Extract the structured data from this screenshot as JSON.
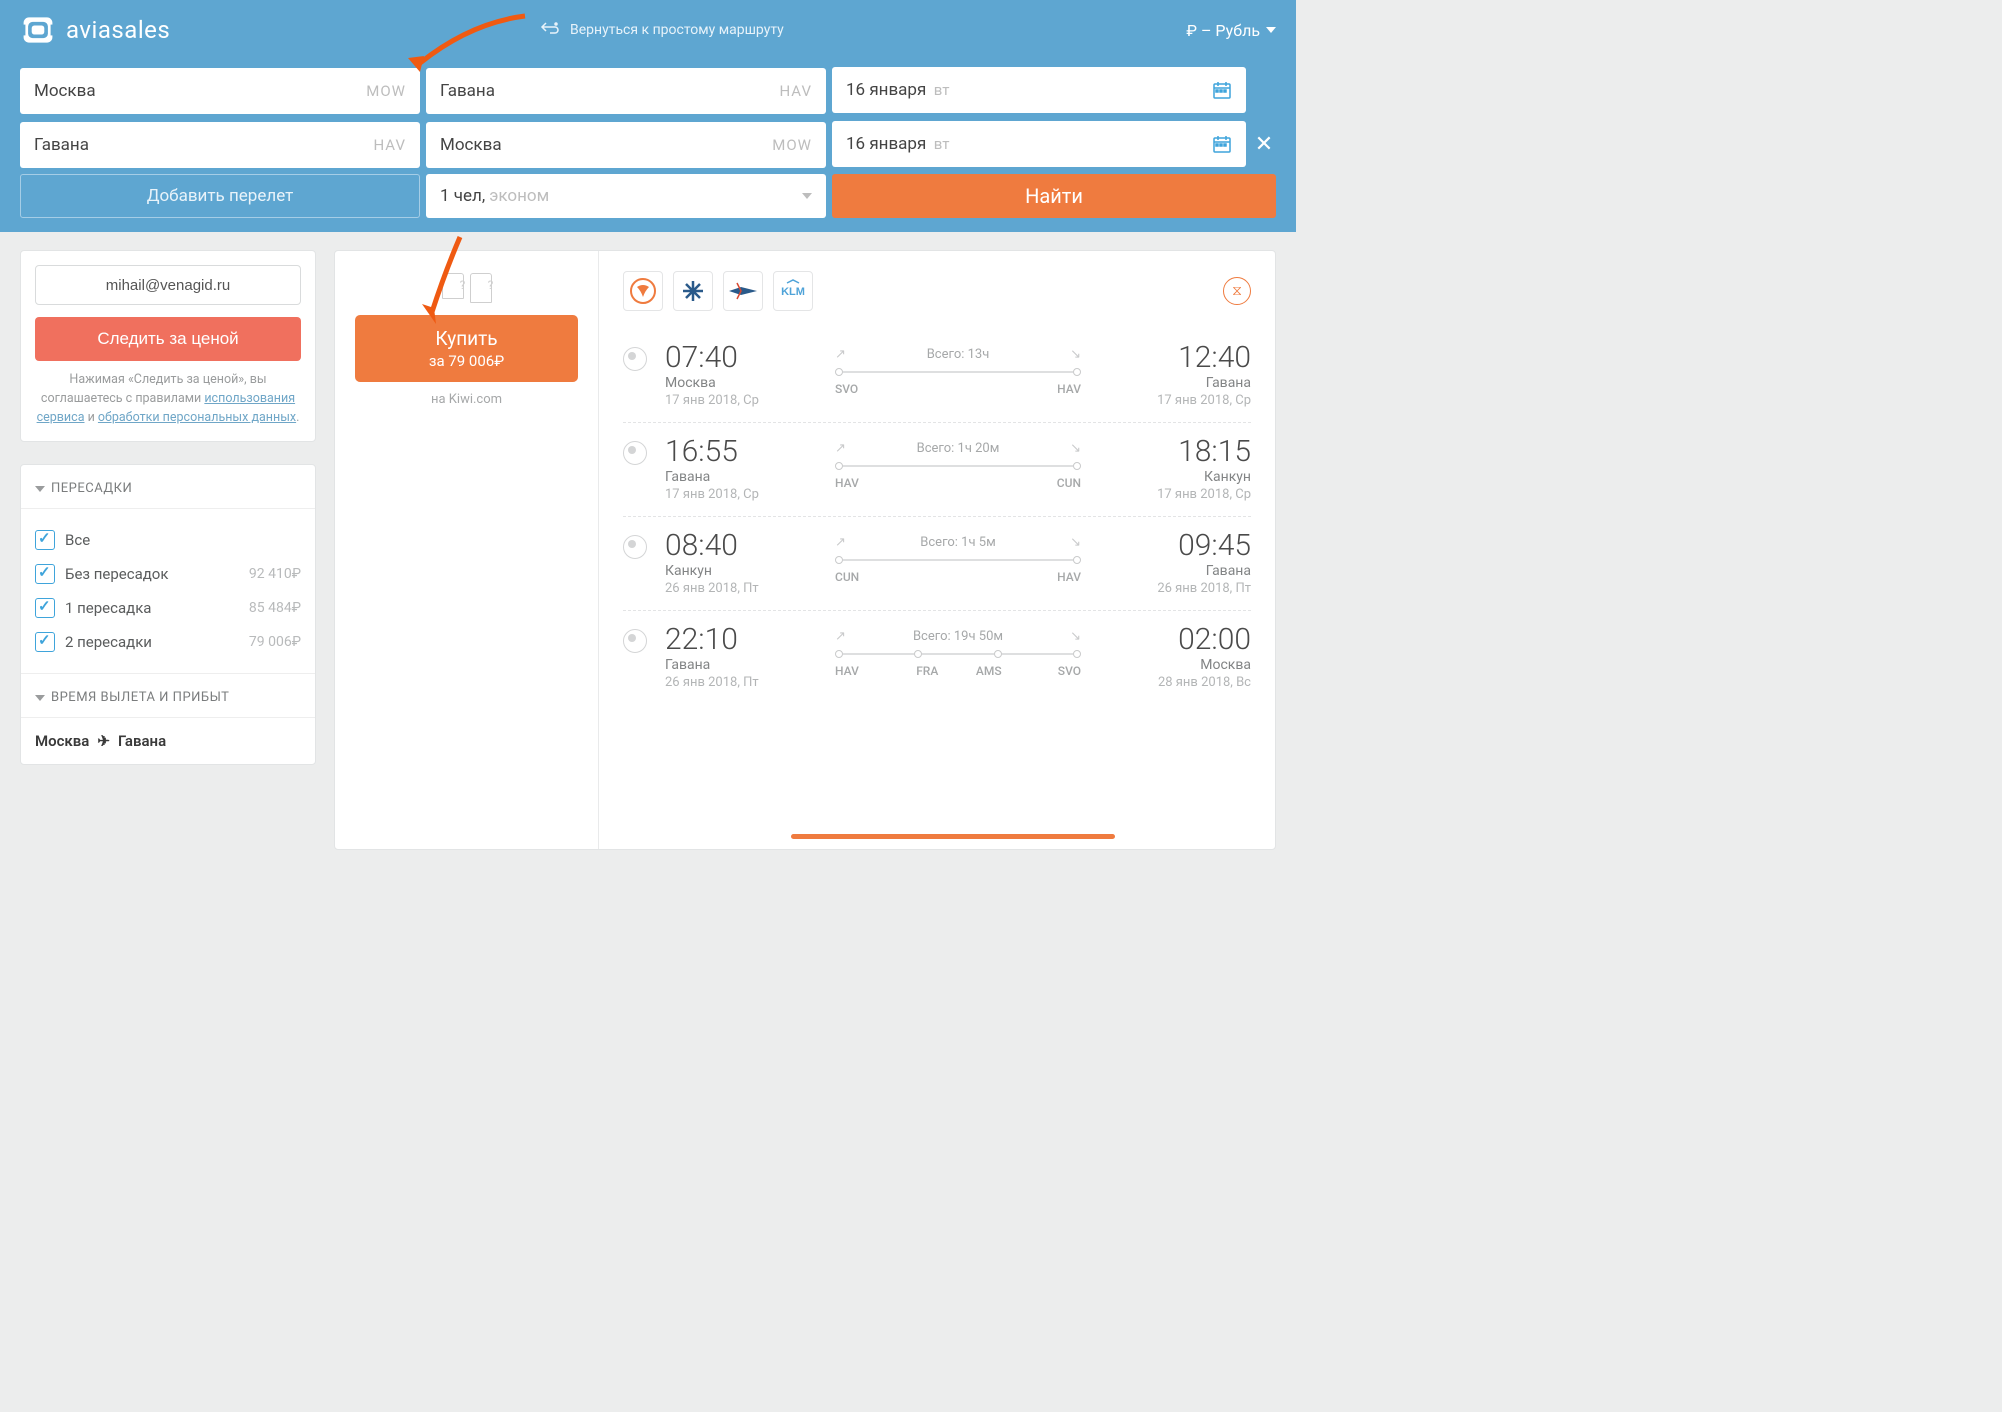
{
  "brand": "aviasales",
  "topbar": {
    "simple_route": "Вернуться к простому маршруту",
    "currency": "₽ – Рубль"
  },
  "search": {
    "rows": [
      {
        "from": "Москва",
        "from_code": "MOW",
        "to": "Гавана",
        "to_code": "HAV",
        "date": "16 января",
        "dow": "вт"
      },
      {
        "from": "Гавана",
        "from_code": "HAV",
        "to": "Москва",
        "to_code": "MOW",
        "date": "16 января",
        "dow": "вт"
      }
    ],
    "add_flight": "Добавить перелет",
    "pax_count": "1 чел,",
    "pax_class": "эконом",
    "submit": "Найти"
  },
  "sidebar": {
    "email": "mihail@venagid.ru",
    "watch": "Следить за ценой",
    "disclaimer_pre": "Нажимая «Следить за ценой», вы соглашаетесь с правилами ",
    "disclaimer_link1": "использования сервиса",
    "disclaimer_mid": " и ",
    "disclaimer_link2": "обработки персональных данных",
    "disclaimer_post": ".",
    "filters": {
      "transfers_title": "ПЕРЕСАДКИ",
      "items": [
        {
          "label": "Все",
          "price": ""
        },
        {
          "label": "Без пересадок",
          "price": "92 410₽"
        },
        {
          "label": "1 пересадка",
          "price": "85 484₽"
        },
        {
          "label": "2 пересадки",
          "price": "79 006₽"
        }
      ],
      "time_title": "ВРЕМЯ ВЫЛЕТА И ПРИБЫТ"
    },
    "route_from": "Москва",
    "route_to": "Гавана"
  },
  "ticket": {
    "buy_label": "Купить",
    "buy_price": "за 79 006₽",
    "via": "на Kiwi.com",
    "airlines": [
      "condor",
      "interjet",
      "aeroflot",
      "klm"
    ],
    "segments": [
      {
        "dep_time": "07:40",
        "dep_city": "Москва",
        "dep_date": "17 янв 2018, Ср",
        "arr_time": "12:40",
        "arr_city": "Гавана",
        "arr_date": "17 янв 2018, Ср",
        "duration": "Всего: 13ч",
        "stops": [
          "SVO",
          "HAV"
        ]
      },
      {
        "dep_time": "16:55",
        "dep_city": "Гавана",
        "dep_date": "17 янв 2018, Ср",
        "arr_time": "18:15",
        "arr_city": "Канкун",
        "arr_date": "17 янв 2018, Ср",
        "duration": "Всего: 1ч 20м",
        "stops": [
          "HAV",
          "CUN"
        ]
      },
      {
        "dep_time": "08:40",
        "dep_city": "Канкун",
        "dep_date": "26 янв 2018, Пт",
        "arr_time": "09:45",
        "arr_city": "Гавана",
        "arr_date": "26 янв 2018, Пт",
        "duration": "Всего: 1ч 5м",
        "stops": [
          "CUN",
          "HAV"
        ]
      },
      {
        "dep_time": "22:10",
        "dep_city": "Гавана",
        "dep_date": "26 янв 2018, Пт",
        "arr_time": "02:00",
        "arr_city": "Москва",
        "arr_date": "28 янв 2018, Вс",
        "duration": "Всего: 19ч 50м",
        "stops": [
          "HAV",
          "FRA",
          "AMS",
          "SVO"
        ]
      }
    ]
  }
}
